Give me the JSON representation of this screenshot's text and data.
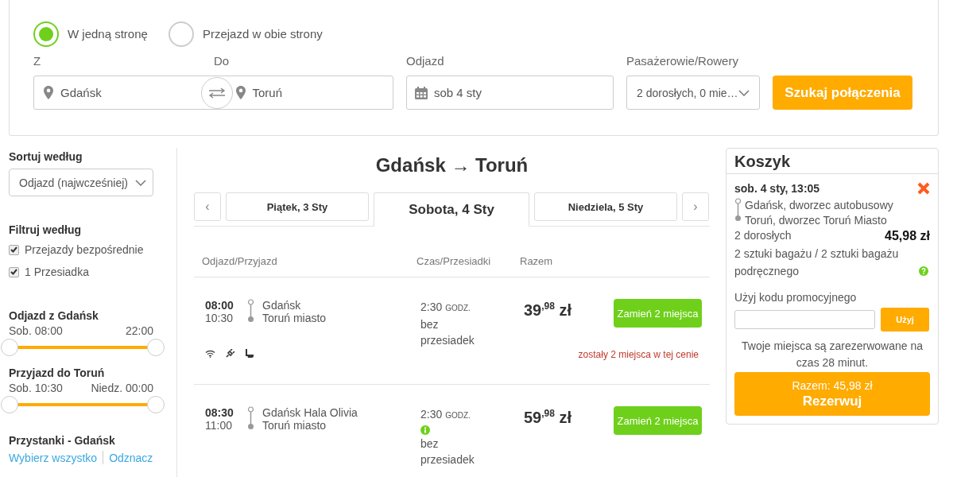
{
  "trip_type": [
    {
      "label": "W jedną stronę",
      "selected": true
    },
    {
      "label": "Przejazd w obie strony",
      "selected": false
    }
  ],
  "search": {
    "from_label": "Z",
    "from": "Gdańsk",
    "to_label": "Do",
    "to": "Toruń",
    "date_label": "Odjazd",
    "date": "sob 4 sty",
    "passengers_label": "Pasażerowie/Rowery",
    "passengers": "2 dorosłych, 0 mie…",
    "button": "Szukaj połączenia"
  },
  "sidebar": {
    "sort_title": "Sortuj według",
    "sort_value": "Odjazd (najwcześniej)",
    "filter_title": "Filtruj według",
    "filters": [
      {
        "label": "Przejazdy bezpośrednie",
        "checked": true
      },
      {
        "label": "1 Przesiadka",
        "checked": true
      }
    ],
    "ranges": [
      {
        "title": "Odjazd z Gdańsk",
        "min": "Sob. 08:00",
        "max": "22:00",
        "level": 1
      },
      {
        "title": "Przyjazd do Toruń",
        "min": "Sob. 10:30",
        "max": "Niedz. 00:00",
        "level": 1
      }
    ],
    "stops_title": "Przystanki - Gdańsk",
    "links": [
      "Wybierz wszystko",
      "Odznacz"
    ]
  },
  "results": {
    "title": "Gdańsk → Toruń",
    "prev": "‹",
    "next": "›",
    "days": [
      {
        "label": "Piątek, 3 Sty",
        "selected": false
      },
      {
        "label": "Sobota, 4 Sty",
        "selected": true
      },
      {
        "label": "Niedziela, 5 Sty",
        "selected": false
      }
    ],
    "columns": [
      "Odjazd/Przyjazd",
      "Czas/Przesiadki",
      "Razem"
    ],
    "rows": [
      {
        "departure": "08:00",
        "arrival": "10:30",
        "from": "Gdańsk",
        "to": "Toruń miasto",
        "duration": "2:30 $_{GODZ.}$",
        "info": false,
        "transfers": "bez przesiadek",
        "price": "39$^{,98}$ zł",
        "button": "Zamień 2 miejsca",
        "note": "zostały 2 miejsca w tej cenie",
        "amenities": true
      },
      {
        "departure": "08:30",
        "arrival": "11:00",
        "from": "Gdańsk Hala Olivia",
        "to": "Toruń miasto",
        "duration": "2:30 $_{GODZ.}$",
        "info": true,
        "transfers": "bez przesiadek",
        "price": "59$^{,98}$ zł",
        "button": "Zamień 2 miejsca",
        "amenities": false
      }
    ]
  },
  "cart": {
    "title": "Koszyk",
    "date": "sob. 4 sty, 13:05",
    "from": "Gdańsk, dworzec autobusowy",
    "to": "Toruń, dworzec Toruń Miasto",
    "passengers": "2 dorosłych",
    "price": "45,98 zł",
    "luggage": "2 sztuki bagażu / 2 sztuki bagażu podręcznego",
    "promo_label": "Użyj kodu promocyjnego",
    "promo_button": "Użyj",
    "notice": "Twoje miejsca są zarezerwowane na czas 28 minut.",
    "total": "Razem: 45,98 zł",
    "book": "Rezerwuj"
  }
}
